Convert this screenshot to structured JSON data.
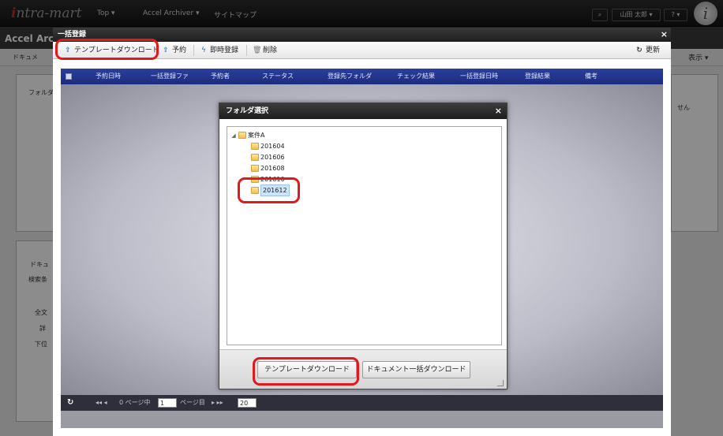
{
  "app": {
    "logo_prefix": "i",
    "logo_rest": "ntra-mart",
    "nav": [
      "Top ▾",
      "Accel Archiver ▾",
      "サイトマップ"
    ],
    "user": "山田 太郎 ▾",
    "help": "? ▾",
    "subtitle": "Accel Arch",
    "doc_label": "ドキュメ",
    "display_label": "表示 ▾",
    "left_panel_text": "フォルダ",
    "side_note": "せん",
    "bottom_panel_tab": "ドキュ",
    "bottom_panel_search": "検索条",
    "bottom_panel_fulltext": "全文",
    "bottom_panel_detail": "詳",
    "bottom_panel_lower": "下位"
  },
  "modal": {
    "title": "一括登録",
    "close": "×",
    "toolbar": {
      "template_download": "テンプレートダウンロード",
      "reserve": "予約",
      "immediate": "即時登録",
      "delete": "削除",
      "refresh": "更新"
    },
    "columns": [
      "予約日時",
      "一括登録ファ",
      "予約者",
      "ステータス",
      "登録先フォルダ",
      "チェック結果",
      "一括登録日時",
      "登録結果",
      "備考"
    ],
    "pager": {
      "nav_first": "◂◂ ◂",
      "page_of": "0 ページ中",
      "page_value": "1",
      "page_suffix": "ページ目",
      "nav_next": "▸ ▸▸",
      "per_page": "20"
    }
  },
  "folder_dialog": {
    "title": "フォルダ選択",
    "close": "×",
    "root": "案件A",
    "folders": [
      "201604",
      "201606",
      "201608",
      "201610",
      "201612"
    ],
    "selected": "201612",
    "buttons": {
      "template_download": "テンプレートダウンロード",
      "bulk_download": "ドキュメント一括ダウンロード"
    }
  }
}
